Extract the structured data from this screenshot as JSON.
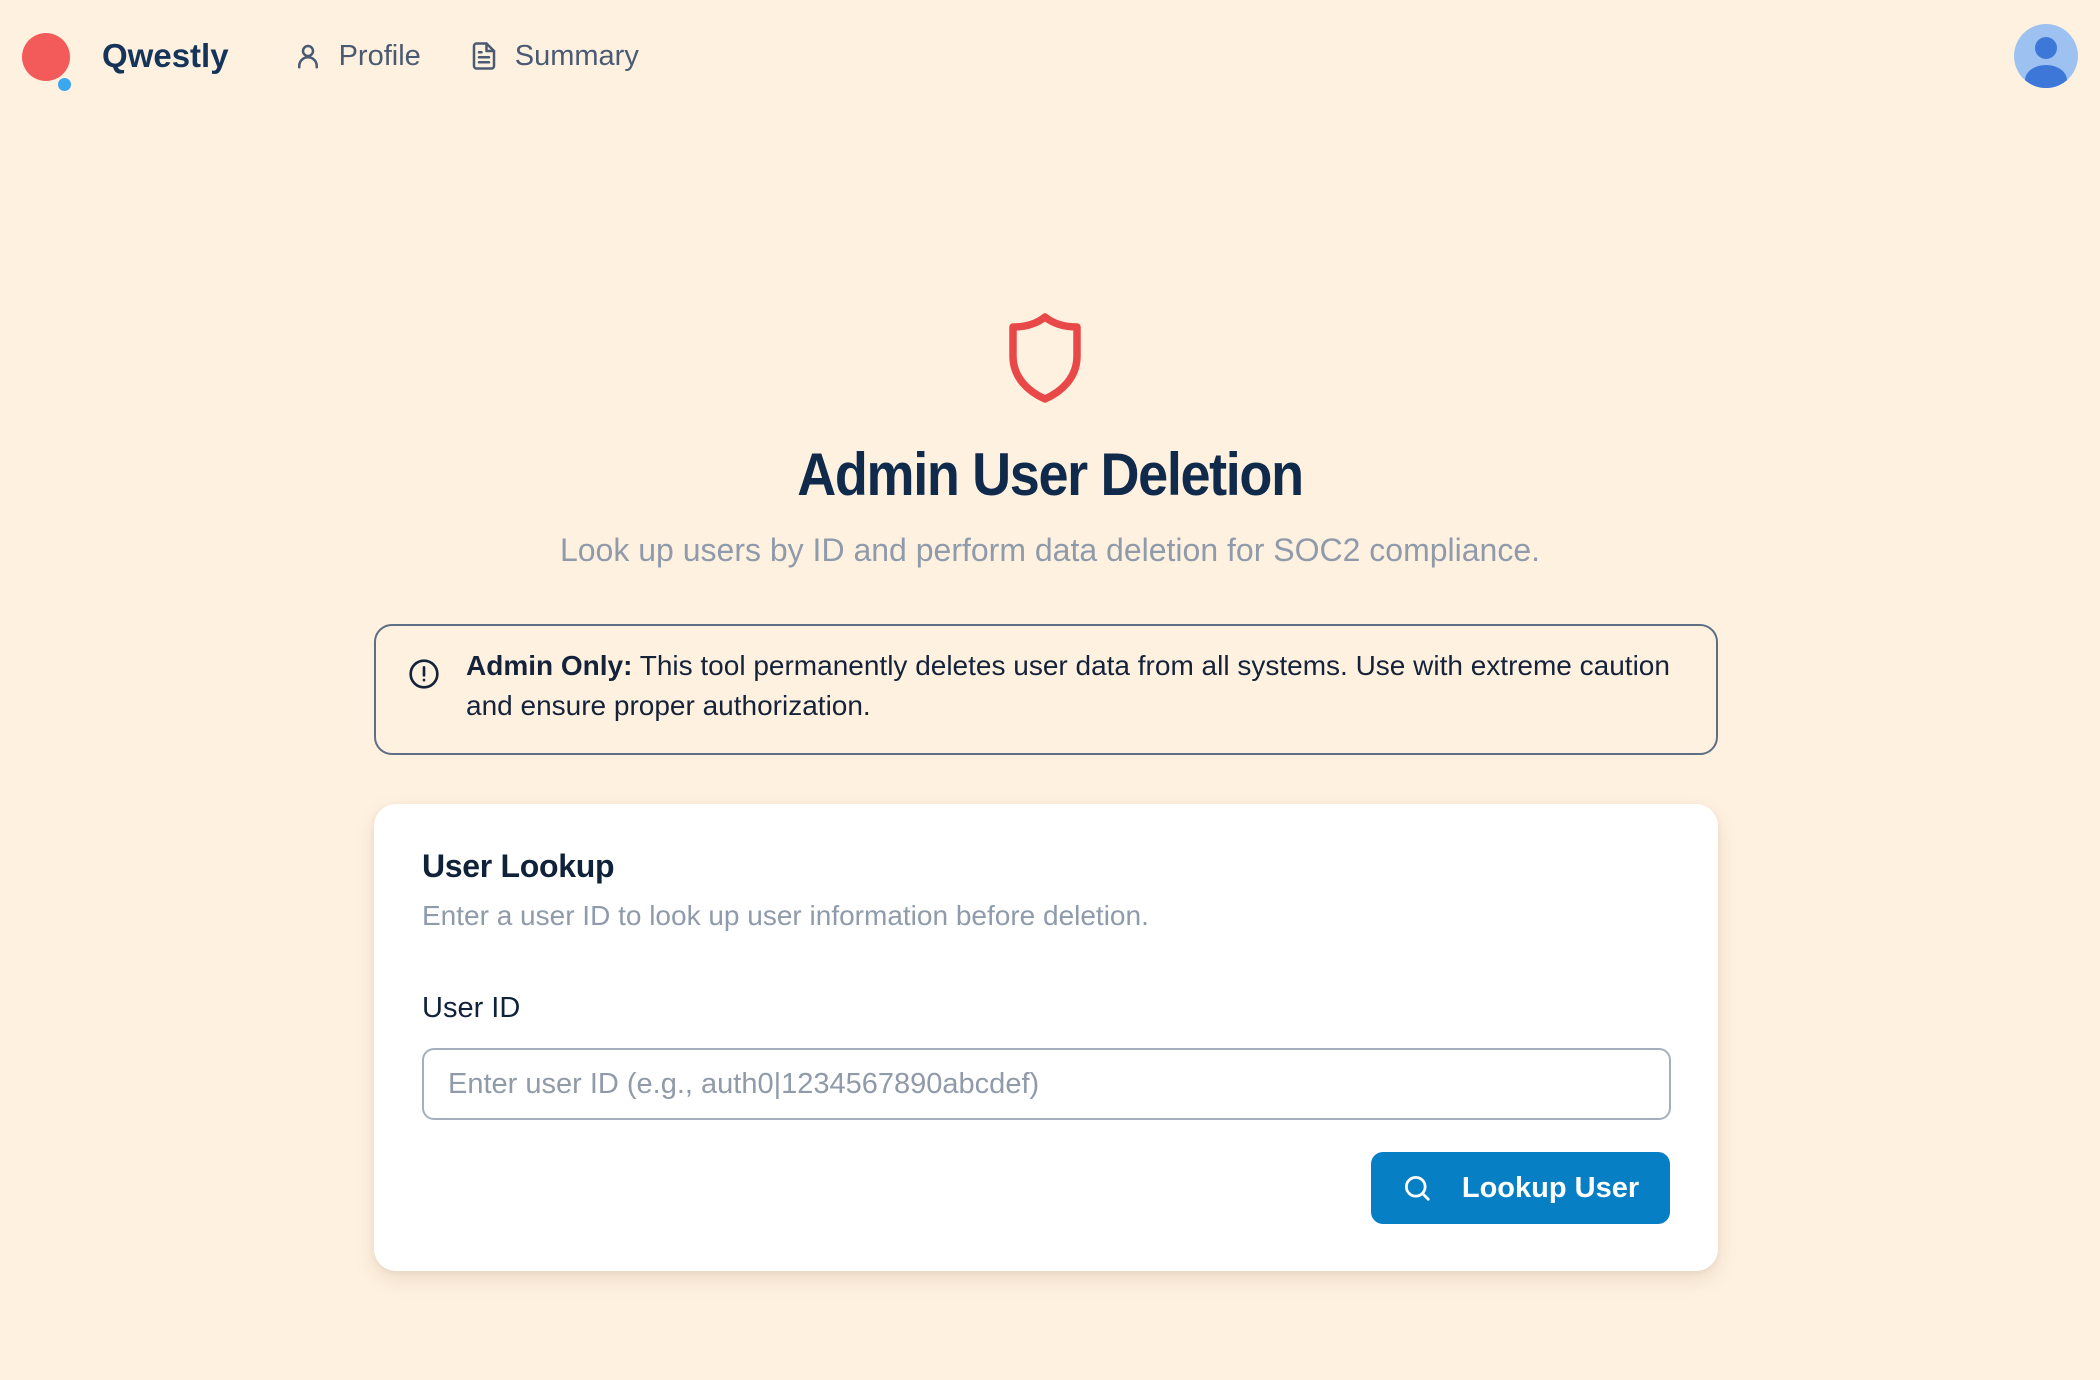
{
  "app": {
    "brand": "Qwestly",
    "logo_icon": "qwestly-logo-icon"
  },
  "nav": {
    "items": [
      {
        "label": "Profile",
        "icon": "user-icon"
      },
      {
        "label": "Summary",
        "icon": "document-icon"
      }
    ],
    "avatar_icon": "avatar-icon"
  },
  "hero": {
    "icon": "shield-icon",
    "title": "Admin User Deletion",
    "subtitle": "Look up users by ID and perform data deletion for SOC2 compliance."
  },
  "alert": {
    "icon": "alert-circle-icon",
    "strong": "Admin Only:",
    "text": " This tool permanently deletes user data from all systems. Use with extreme caution and ensure proper authorization."
  },
  "lookup": {
    "title": "User Lookup",
    "description": "Enter a user ID to look up user information before deletion.",
    "field_label": "User ID",
    "input_value": "",
    "input_placeholder": "Enter user ID (e.g., auth0|1234567890abcdef)",
    "button_label": "Lookup User",
    "button_icon": "search-icon"
  },
  "colors": {
    "background": "#fff1e0",
    "accent": "#067fc4",
    "danger": "#e94848",
    "brand_primary": "#f35a5a",
    "brand_secondary": "#3aa8ee"
  }
}
